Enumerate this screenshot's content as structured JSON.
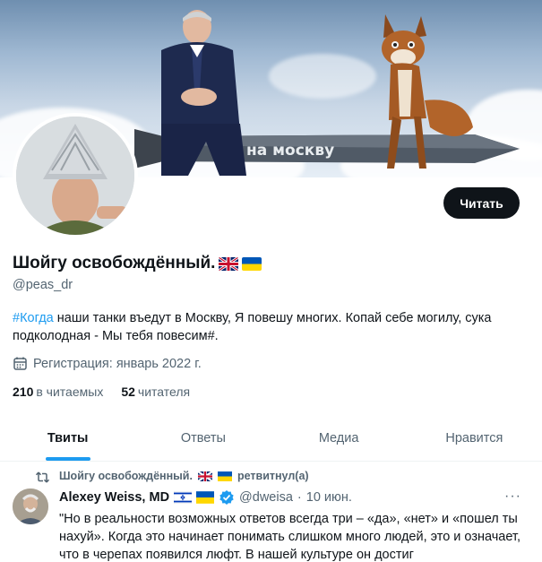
{
  "banner": {
    "missile_text": "на москву"
  },
  "actions": {
    "follow_label": "Читать"
  },
  "profile": {
    "display_name": "Шойгу освобождённый.",
    "handle": "@peas_dr",
    "bio_hashtag": "#Когда",
    "bio_rest": " наши танки въедут в Москву, Я повешу многих. Копай себе могилу, сука подколодная - Мы тебя повесим#.",
    "joined": "Регистрация: январь 2022 г.",
    "following_count": "210",
    "following_label": "в читаемых",
    "followers_count": "52",
    "followers_label": "читателя"
  },
  "tabs": [
    {
      "label": "Твиты",
      "active": true
    },
    {
      "label": "Ответы",
      "active": false
    },
    {
      "label": "Медиа",
      "active": false
    },
    {
      "label": "Нравится",
      "active": false
    }
  ],
  "tweet": {
    "retweeted_by": "Шойгу освобождённый.",
    "retweeted_suffix": "ретвитнул(а)",
    "author_name": "Alexey Weiss, MD",
    "author_handle": "@dweisa",
    "separator": "·",
    "date": "10 июн.",
    "more_label": "···",
    "text": "\"Но в реальности возможных ответов всегда три – «да», «нет» и «пошел ты нахуй». Когда это начинает понимать слишком много людей, это и означает, что в черепах появился люфт. В нашей культуре он достиг"
  },
  "colors": {
    "accent": "#1d9bf0",
    "text_primary": "#0f1419",
    "text_secondary": "#536471",
    "button_dark": "#0f1419"
  },
  "icons": [
    "calendar-icon",
    "retweet-icon",
    "verified-icon",
    "uk-flag-icon",
    "ukraine-flag-icon",
    "israel-flag-icon"
  ]
}
